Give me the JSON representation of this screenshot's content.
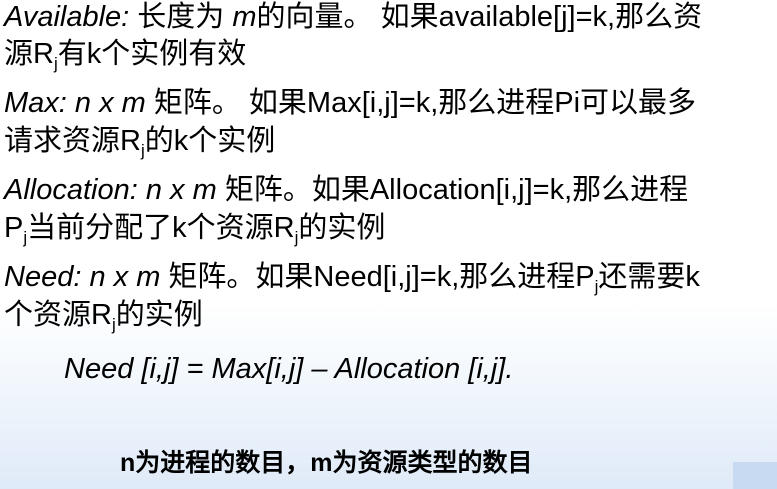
{
  "definitions": [
    {
      "term": "Available:",
      "lines": [
        [
          "长度为 ",
          {
            "i": "m"
          },
          "的向量。 如果available[j]=k,那么资"
        ],
        [
          "源R",
          {
            "sub": "j"
          },
          "有k个实例有效"
        ]
      ]
    },
    {
      "term": "Max:",
      "lines": [
        [
          " ",
          {
            "i": "n x m"
          },
          " 矩阵。 如果Max[i,j]=k,那么进程Pi可以最多"
        ],
        [
          "请求资源R",
          {
            "sub": "j"
          },
          "的k个实例"
        ]
      ]
    },
    {
      "term": "Allocation:",
      "lines": [
        [
          "  ",
          {
            "i": "n x m"
          },
          " 矩阵。如果Allocation[i,j]=k,那么进程"
        ],
        [
          "P",
          {
            "sub": "j"
          },
          "当前分配了k个资源R",
          {
            "sub": "j"
          },
          "的实例"
        ]
      ]
    },
    {
      "term": "Need:",
      "lines": [
        "  ",
        [
          "  ",
          {
            "i": "n x m"
          },
          " 矩阵。如果Need[i,j]=k,那么进程P",
          {
            "sub": "j"
          },
          "还需要k"
        ],
        [
          "个资源R",
          {
            "sub": "j"
          },
          "的实例"
        ]
      ]
    }
  ],
  "formula": "Need [i,j] = Max[i,j] – Allocation [i,j].",
  "footer": "n为进程的数目，m为资源类型的数目"
}
